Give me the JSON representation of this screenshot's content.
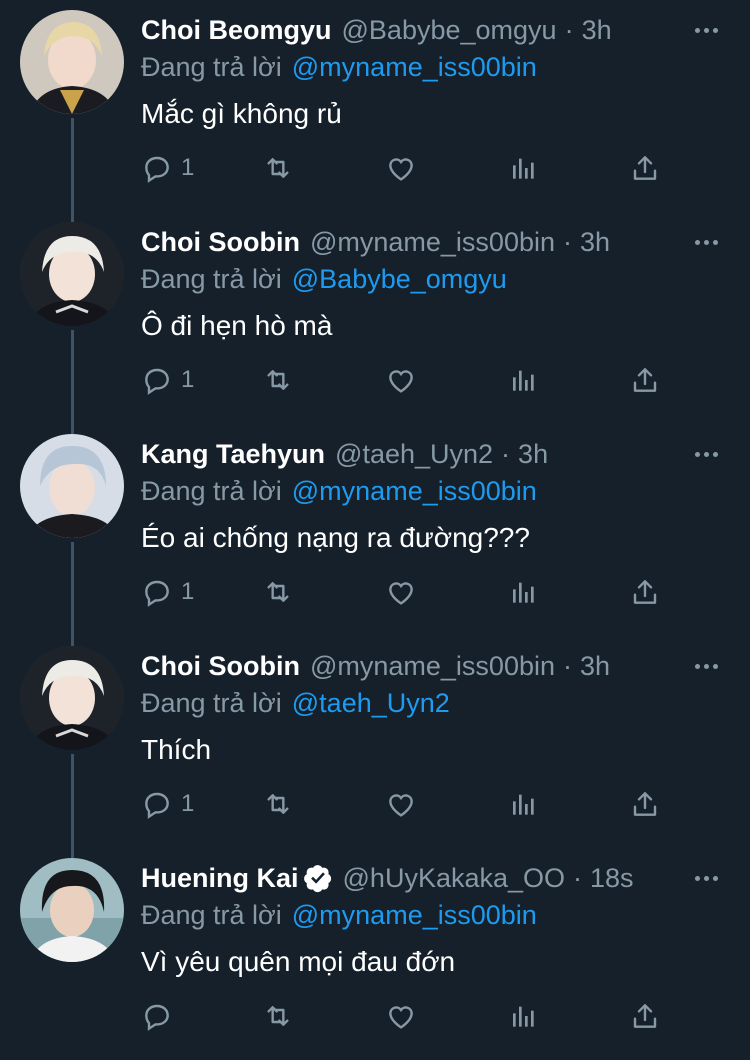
{
  "colors": {
    "background": "#15202b",
    "text_primary": "#ffffff",
    "text_secondary": "#8899a6",
    "mention_blue": "#1d9bf0",
    "thread_line": "#3d5466"
  },
  "reply_prefix": "Đang trả lời",
  "tweets": [
    {
      "name": "Choi Beomgyu",
      "handle": "@Babybe_omgyu",
      "time": "3h",
      "verified": false,
      "reply_to": "@myname_iss00bin",
      "text": "Mắc gì không rủ",
      "reply_count": "1",
      "avatar": "blonde-hair-avatar"
    },
    {
      "name": "Choi Soobin",
      "handle": "@myname_iss00bin",
      "time": "3h",
      "verified": false,
      "reply_to": "@Babybe_omgyu",
      "text": "Ô đi hẹn hò mà",
      "reply_count": "1",
      "avatar": "light-hair-avatar"
    },
    {
      "name": "Kang Taehyun",
      "handle": "@taeh_Uyn2",
      "time": "3h",
      "verified": false,
      "reply_to": "@myname_iss00bin",
      "text": "Éo ai chống nạng ra đường???",
      "reply_count": "1",
      "avatar": "silver-hair-avatar"
    },
    {
      "name": "Choi Soobin",
      "handle": "@myname_iss00bin",
      "time": "3h",
      "verified": false,
      "reply_to": "@taeh_Uyn2",
      "text": "Thích",
      "reply_count": "1",
      "avatar": "light-hair-avatar"
    },
    {
      "name": "Huening Kai",
      "handle": "@hUyKakaka_OO",
      "time": "18s",
      "verified": true,
      "reply_to": "@myname_iss00bin",
      "text": "Vì yêu quên mọi đau đớn",
      "reply_count": "",
      "avatar": "dark-hair-avatar"
    }
  ],
  "icons": [
    "reply-icon",
    "retweet-icon",
    "like-icon",
    "analytics-icon",
    "share-icon",
    "more-icon",
    "verified-badge-icon"
  ]
}
